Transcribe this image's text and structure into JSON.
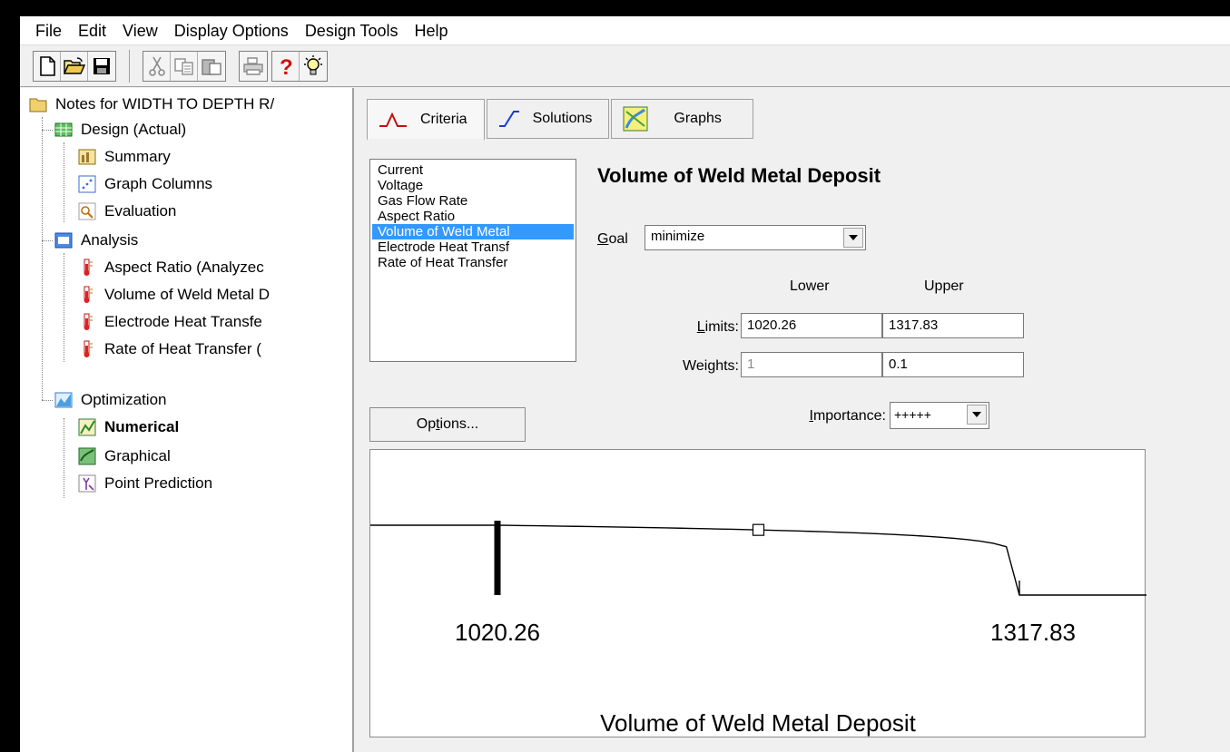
{
  "menu": [
    "File",
    "Edit",
    "View",
    "Display Options",
    "Design Tools",
    "Help"
  ],
  "toolbar": {
    "buttons": [
      "new-icon",
      "open-icon",
      "save-icon",
      "cut-icon",
      "copy-icon",
      "paste-icon",
      "print-icon",
      "help-icon",
      "tip-icon"
    ]
  },
  "tree": {
    "root": "Notes for WIDTH TO DEPTH R/",
    "design": "Design (Actual)",
    "summary": "Summary",
    "graph_columns": "Graph Columns",
    "evaluation": "Evaluation",
    "analysis": "Analysis",
    "aspect_ratio": "Aspect Ratio (Analyzec",
    "volume": "Volume of Weld Metal D",
    "electrode": "Electrode Heat Transfe",
    "rate": "Rate of Heat Transfer (",
    "optimization": "Optimization",
    "numerical": "Numerical",
    "graphical": "Graphical",
    "point_prediction": "Point Prediction"
  },
  "tabs": {
    "criteria": "Criteria",
    "solutions": "Solutions",
    "graphs": "Graphs"
  },
  "responses": {
    "items": [
      "Current",
      "Voltage",
      "Gas Flow Rate",
      "Aspect Ratio",
      "Volume of Weld Metal",
      "Electrode Heat Transf",
      "Rate of Heat Transfer"
    ],
    "selected": "Volume of Weld Metal"
  },
  "criteria": {
    "title": "Volume of Weld Metal Deposit",
    "goal_label_key": "G",
    "goal_label_rest": "oal",
    "goal_value": "minimize",
    "lower_head": "Lower",
    "upper_head": "Upper",
    "limits_label_key": "L",
    "limits_label_rest": "imits:",
    "lower_limit": "1020.26",
    "upper_limit": "1317.83",
    "weights_label": "Weights:",
    "lower_weight": "1",
    "upper_weight": "0.1",
    "importance_label_key": "I",
    "importance_label_rest": "mportance:",
    "importance_value": "+++++",
    "options_pre": "Op",
    "options_key": "t",
    "options_post": "ions..."
  },
  "chart_data": {
    "type": "line",
    "title": "",
    "xlabel": "Volume of Weld Metal Deposit",
    "ylabel": "",
    "x_ticks": [
      "1020.26",
      "1317.83"
    ],
    "lower": 1020.26,
    "upper": 1317.83,
    "weight_upper": 0.1
  }
}
